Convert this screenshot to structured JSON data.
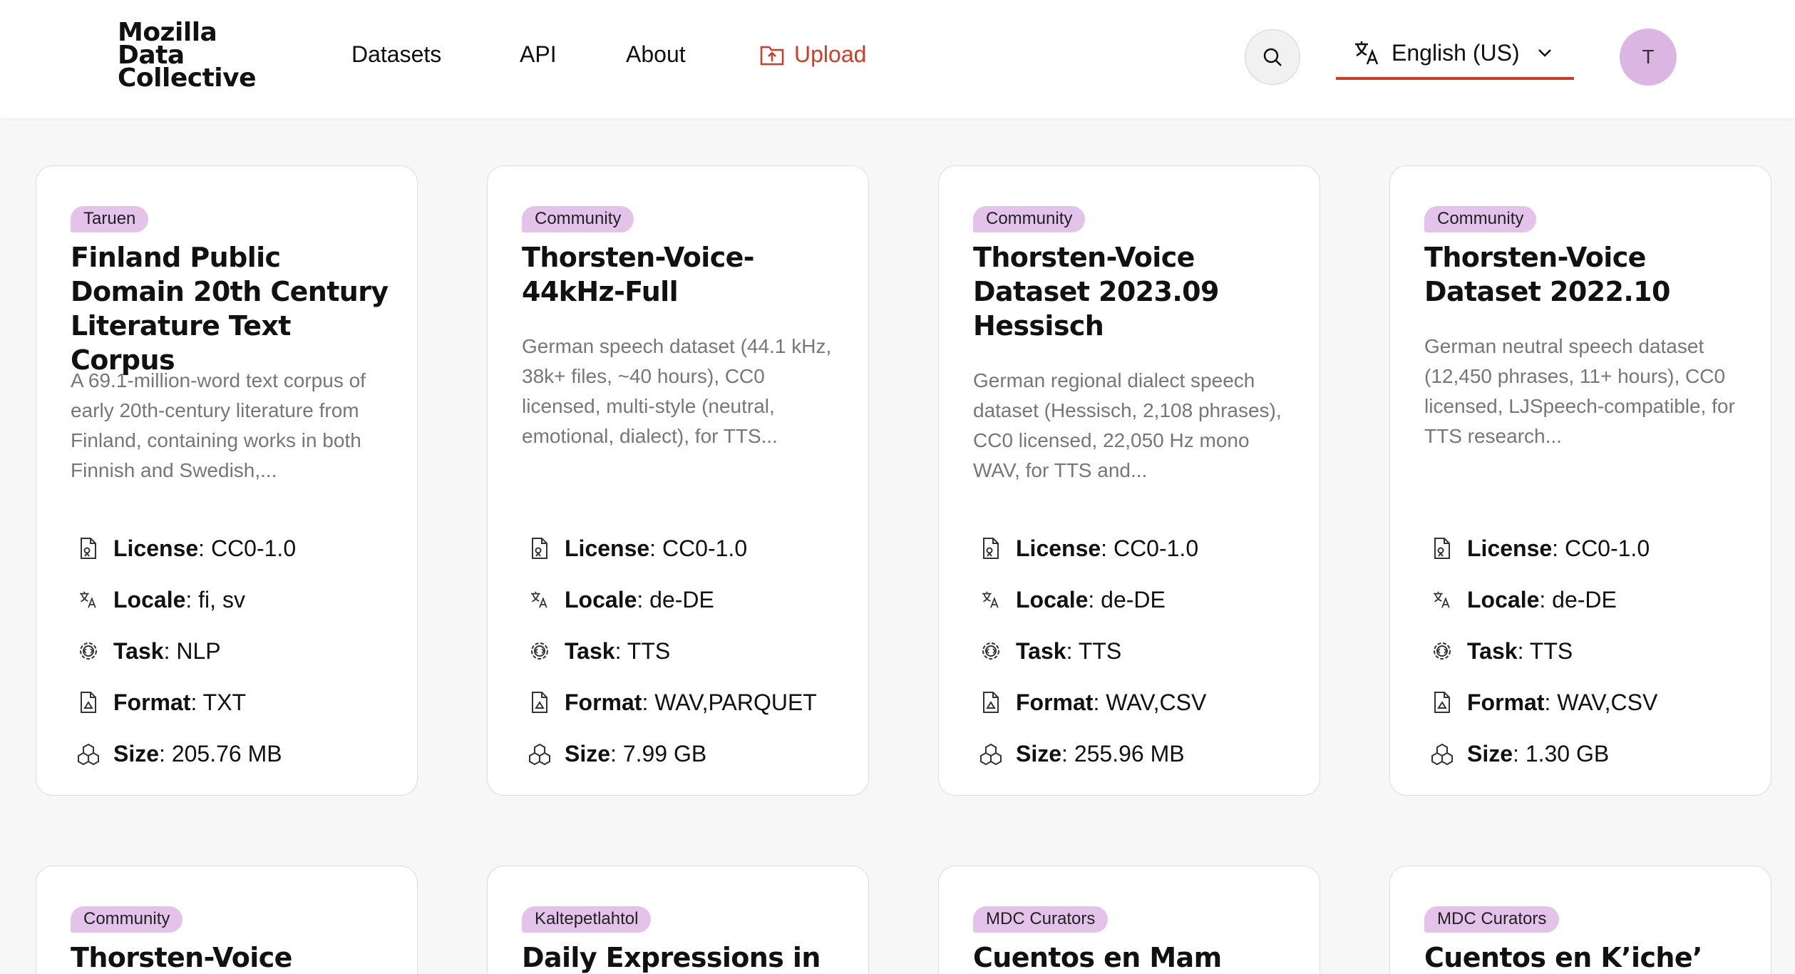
{
  "header": {
    "logo_line1": "Mozilla",
    "logo_line2": "Data",
    "logo_line3": "Collective",
    "nav": {
      "datasets": "Datasets",
      "api": "API",
      "about": "About",
      "upload": "Upload"
    },
    "search_icon": "search-icon",
    "language": "English (US)",
    "avatar_initial": "T"
  },
  "colors": {
    "accent": "#d23c24",
    "badge": "#e3c3ea",
    "avatar": "#dcb6e3"
  },
  "labels": {
    "license": "License",
    "locale": "Locale",
    "task": "Task",
    "format": "Format",
    "size": "Size"
  },
  "cards": [
    {
      "badge": "Taruen",
      "title": "Finland Public Domain 20th Century Literature Text Corpus",
      "description": "A 69.1-million-word text corpus of early 20th-century literature from Finland, containing works in both Finnish and Swedish,...",
      "license": ": CC0-1.0",
      "locale": ": fi, sv",
      "task": ": NLP",
      "format": ": TXT",
      "size": ": 205.76 MB"
    },
    {
      "badge": "Community",
      "title": "Thorsten-Voice-44kHz-Full",
      "description": "German speech dataset (44.1 kHz, 38k+ files, ~40 hours), CC0 licensed, multi-style (neutral, emotional, dialect), for TTS...",
      "license": ": CC0-1.0",
      "locale": ": de-DE",
      "task": ": TTS",
      "format": ": WAV,PARQUET",
      "size": ": 7.99 GB"
    },
    {
      "badge": "Community",
      "title": "Thorsten-Voice Dataset 2023.09 Hessisch",
      "description": "German regional dialect speech dataset (Hessisch, 2,108 phrases), CC0 licensed, 22,050 Hz mono WAV, for TTS and...",
      "license": ": CC0-1.0",
      "locale": ": de-DE",
      "task": ": TTS",
      "format": ": WAV,CSV",
      "size": ": 255.96 MB"
    },
    {
      "badge": "Community",
      "title": "Thorsten-Voice Dataset 2022.10",
      "description": "German neutral speech dataset (12,450 phrases, 11+ hours), CC0 licensed, LJSpeech-compatible, for TTS research...",
      "license": ": CC0-1.0",
      "locale": ": de-DE",
      "task": ": TTS",
      "format": ": WAV,CSV",
      "size": ": 1.30 GB"
    },
    {
      "badge": "Community",
      "title": "Thorsten-Voice"
    },
    {
      "badge": "Kaltepetlahtol",
      "title": "Daily Expressions in"
    },
    {
      "badge": "MDC Curators",
      "title": "Cuentos en Mam"
    },
    {
      "badge": "MDC Curators",
      "title": "Cuentos en K’iche’"
    }
  ]
}
